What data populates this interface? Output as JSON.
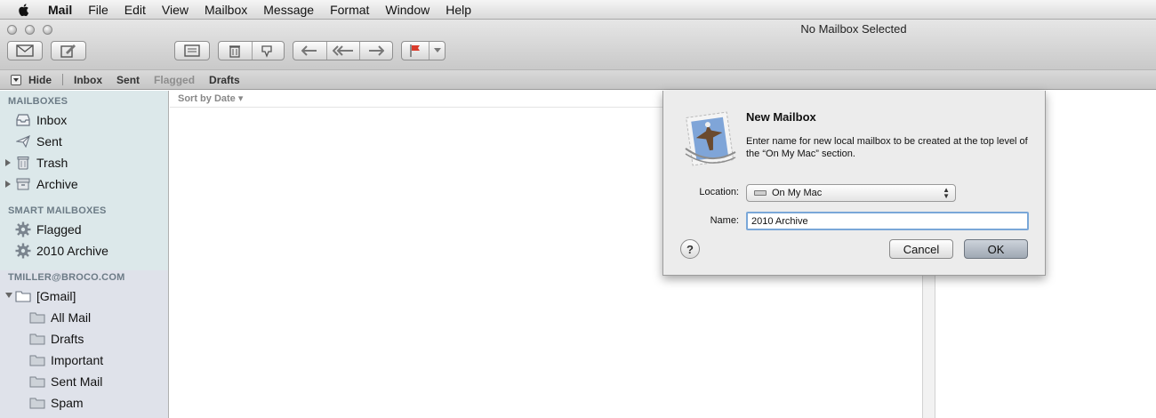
{
  "menubar": {
    "apple_icon": "apple-logo-icon",
    "app_name": "Mail",
    "items": [
      "File",
      "Edit",
      "View",
      "Mailbox",
      "Message",
      "Format",
      "Window",
      "Help"
    ]
  },
  "window": {
    "title": "No Mailbox Selected"
  },
  "toolbar": {
    "icons": [
      "get-mail-icon",
      "compose-icon",
      "archive-icon",
      "trash-icon",
      "junk-icon",
      "reply-icon",
      "reply-all-icon",
      "forward-icon",
      "flag-icon"
    ]
  },
  "favorites": {
    "hide_label": "Hide",
    "items": [
      {
        "label": "Inbox",
        "dim": false
      },
      {
        "label": "Sent",
        "dim": false
      },
      {
        "label": "Flagged",
        "dim": true
      },
      {
        "label": "Drafts",
        "dim": false
      }
    ]
  },
  "sidebar": {
    "mailboxes_header": "MAILBOXES",
    "mailboxes": [
      {
        "label": "Inbox",
        "icon": "inbox-tray-icon"
      },
      {
        "label": "Sent",
        "icon": "paper-plane-icon"
      },
      {
        "label": "Trash",
        "icon": "trash-can-icon"
      },
      {
        "label": "Archive",
        "icon": "archive-box-icon"
      }
    ],
    "smart_header": "SMART MAILBOXES",
    "smart": [
      {
        "label": "Flagged",
        "icon": "gear-icon"
      },
      {
        "label": "2010 Archive",
        "icon": "gear-icon"
      }
    ],
    "account_header": "TMILLER@BROCO.COM",
    "account_root": {
      "label": "[Gmail]",
      "icon": "folder-icon"
    },
    "account_folders": [
      {
        "label": "All Mail"
      },
      {
        "label": "Drafts"
      },
      {
        "label": "Important"
      },
      {
        "label": "Sent Mail"
      },
      {
        "label": "Spam"
      }
    ]
  },
  "list": {
    "sort_label": "Sort by Date ▾"
  },
  "dialog": {
    "icon": "mail-stamp-eagle-icon",
    "title": "New Mailbox",
    "description": "Enter name for new local mailbox to be created at the top level of the “On My Mac” section.",
    "location_label": "Location:",
    "location_value": "On My Mac",
    "name_label": "Name:",
    "name_value": "2010 Archive",
    "help_label": "?",
    "cancel_label": "Cancel",
    "ok_label": "OK"
  }
}
